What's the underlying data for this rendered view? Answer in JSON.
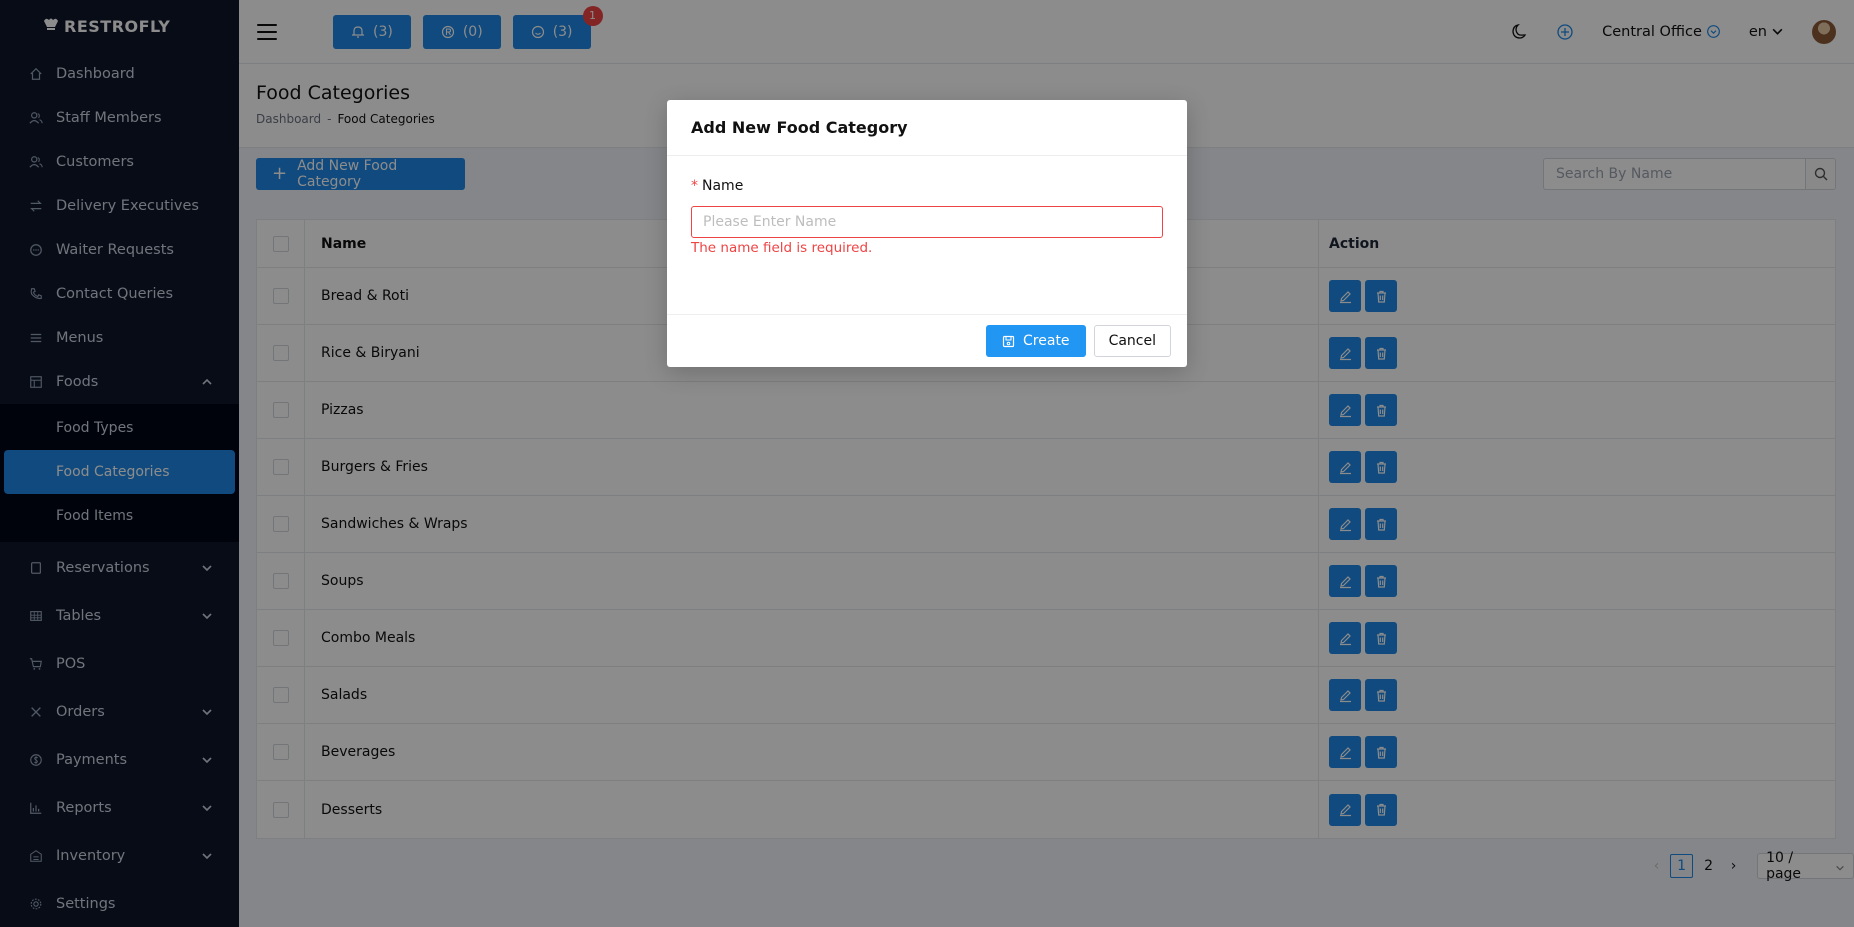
{
  "brand": {
    "name": "RESTROFLY",
    "logo_icon": "chef-hat-icon"
  },
  "sidebar": {
    "items": [
      {
        "label": "Dashboard",
        "icon": "home-icon"
      },
      {
        "label": "Staff Members",
        "icon": "users-icon"
      },
      {
        "label": "Customers",
        "icon": "users-icon"
      },
      {
        "label": "Delivery Executives",
        "icon": "swap-icon"
      },
      {
        "label": "Waiter Requests",
        "icon": "chat-icon"
      },
      {
        "label": "Contact Queries",
        "icon": "phone-icon"
      },
      {
        "label": "Menus",
        "icon": "list-icon"
      },
      {
        "label": "Foods",
        "icon": "grid-icon",
        "expanded": true
      }
    ],
    "food_sub": [
      {
        "label": "Food Types",
        "active": false
      },
      {
        "label": "Food Categories",
        "active": true
      },
      {
        "label": "Food Items",
        "active": false
      }
    ],
    "items_after": [
      {
        "label": "Reservations",
        "icon": "book-icon",
        "has_chevron": true
      },
      {
        "label": "Tables",
        "icon": "table-icon",
        "has_chevron": true
      },
      {
        "label": "POS",
        "icon": "cart-icon",
        "has_chevron": false
      },
      {
        "label": "Orders",
        "icon": "cross-icon",
        "has_chevron": true
      },
      {
        "label": "Payments",
        "icon": "dollar-icon",
        "has_chevron": true
      },
      {
        "label": "Reports",
        "icon": "bar-chart-icon",
        "has_chevron": true
      },
      {
        "label": "Inventory",
        "icon": "warehouse-icon",
        "has_chevron": true
      },
      {
        "label": "Settings",
        "icon": "gear-icon",
        "has_chevron": false
      }
    ]
  },
  "topbar": {
    "pills": [
      {
        "label": "(3)",
        "icon": "bell-icon"
      },
      {
        "label": "(0)",
        "icon": "reservation-icon"
      },
      {
        "label": "(3)",
        "icon": "smile-icon",
        "badge": "1"
      }
    ],
    "branch": "Central Office",
    "language": "en"
  },
  "page": {
    "title": "Food Categories",
    "breadcrumb": {
      "parent": "Dashboard",
      "sep": "-",
      "current": "Food Categories"
    },
    "add_button": "Add New Food Category",
    "search_placeholder": "Search By Name"
  },
  "table": {
    "headers": {
      "name": "Name",
      "action": "Action"
    },
    "rows": [
      "Bread & Roti",
      "Rice & Biryani",
      "Pizzas",
      "Burgers & Fries",
      "Sandwiches & Wraps",
      "Soups",
      "Combo Meals",
      "Salads",
      "Beverages",
      "Desserts"
    ]
  },
  "pagination": {
    "pages": [
      "1",
      "2"
    ],
    "current": "1",
    "page_size": "10 / page"
  },
  "modal": {
    "title": "Add New Food Category",
    "field_label": "Name",
    "required_mark": "*",
    "placeholder": "Please Enter Name",
    "error": "The name field is required.",
    "create_label": "Create",
    "cancel_label": "Cancel"
  },
  "colors": {
    "primary": "#1e88e5",
    "sidebar": "#0f172a",
    "error": "#ef4444"
  }
}
